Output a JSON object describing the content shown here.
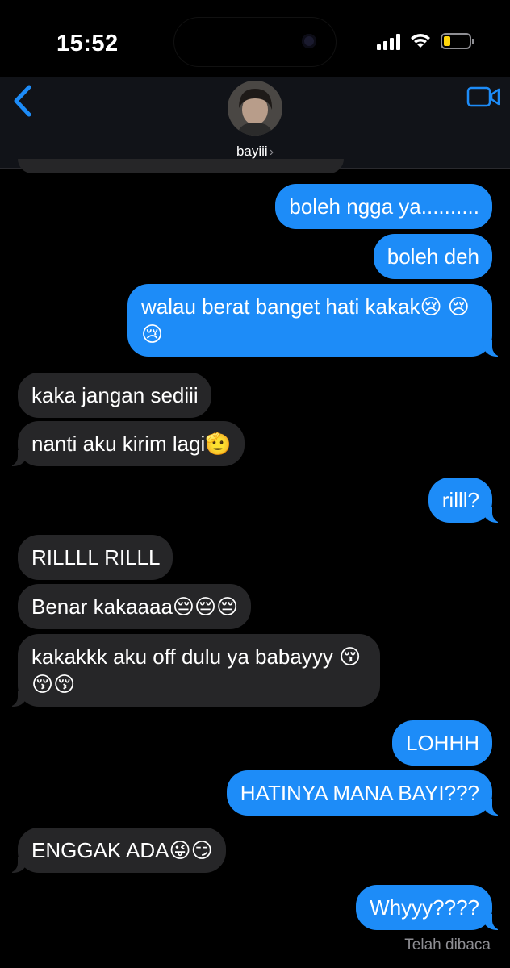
{
  "status": {
    "time": "15:52",
    "battery_color": "#ffd60a",
    "battery_level": 0.25
  },
  "header": {
    "back_icon": "chevron-left-icon",
    "contact_name": "bayiii",
    "contact_chevron": "›",
    "video_icon": "video-camera-icon",
    "accent": "#1d8cf8"
  },
  "messages": [
    {
      "dir": "out",
      "text": "boleh ngga ya.........."
    },
    {
      "dir": "out",
      "text": "boleh deh"
    },
    {
      "dir": "out",
      "text": "walau berat banget hati kakak😢 😢😢"
    },
    {
      "dir": "in",
      "text": "kaka jangan sediii"
    },
    {
      "dir": "in",
      "text": "nanti aku kirim lagi🫡"
    },
    {
      "dir": "out",
      "text": "rilll?"
    },
    {
      "dir": "in",
      "text": "RILLLL RILLL"
    },
    {
      "dir": "in",
      "text": "Benar kakaaaa😔😔😔"
    },
    {
      "dir": "in",
      "text": "kakakkk aku off dulu ya babayyy 😚😚😚"
    },
    {
      "dir": "out",
      "text": "LOHHH"
    },
    {
      "dir": "out",
      "text": "HATINYA MANA BAYI???"
    },
    {
      "dir": "in",
      "text": "ENGGAK ADA😜😏"
    },
    {
      "dir": "out",
      "text": "Whyyy????"
    }
  ],
  "read_receipt": "Telah dibaca"
}
